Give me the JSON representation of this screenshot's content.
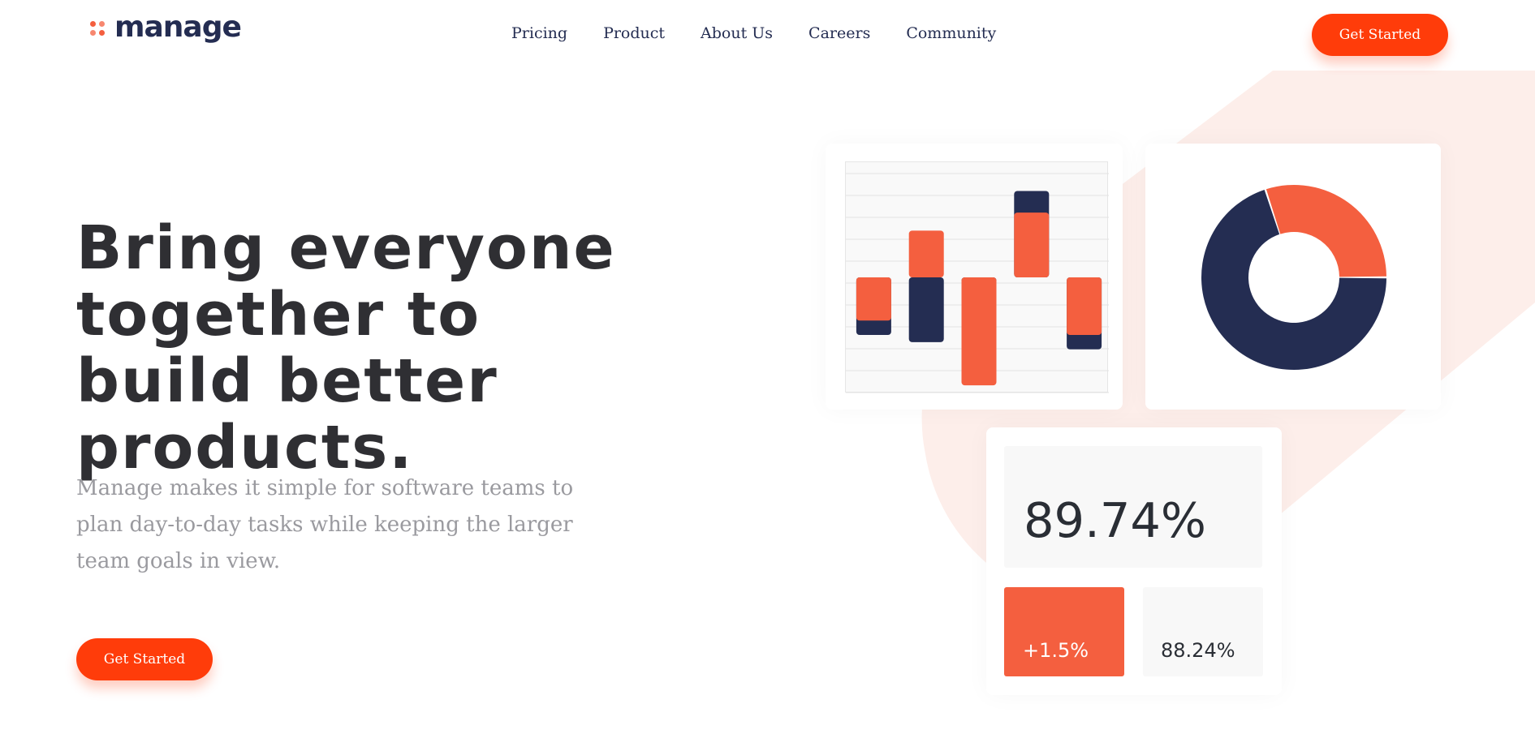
{
  "brand": {
    "name": "manage"
  },
  "nav": {
    "items": [
      "Pricing",
      "Product",
      "About Us",
      "Careers",
      "Community"
    ],
    "cta_label": "Get Started"
  },
  "hero": {
    "title": "Bring everyone together to build better products.",
    "description": "Manage makes it simple for software teams to plan day-to-day tasks while keeping the larger team goals in view.",
    "cta_label": "Get Started"
  },
  "colors": {
    "accent": "#ff3c0a",
    "chart_orange": "#f45f3f",
    "navy": "#242d52",
    "peach": "#fdeeea"
  },
  "dashboard": {
    "bar_chart": {
      "type": "bar",
      "series": [
        {
          "name": "navy",
          "color": "#242d52",
          "values": [
            -1.6,
            -1.8,
            -1.2,
            2.4,
            -2.0
          ]
        },
        {
          "name": "orange",
          "color": "#f45f3f",
          "values": [
            -1.2,
            1.3,
            -3.0,
            1.8,
            -1.6
          ]
        }
      ],
      "ylim": [
        -3.2,
        3.2
      ],
      "grid": true
    },
    "donut": {
      "type": "pie",
      "slices": [
        {
          "value": 70,
          "color": "#242d52"
        },
        {
          "value": 30,
          "color": "#f45f3f"
        }
      ]
    },
    "stats": {
      "main": "89.74%",
      "change": "+1.5%",
      "secondary": "88.24%"
    }
  }
}
